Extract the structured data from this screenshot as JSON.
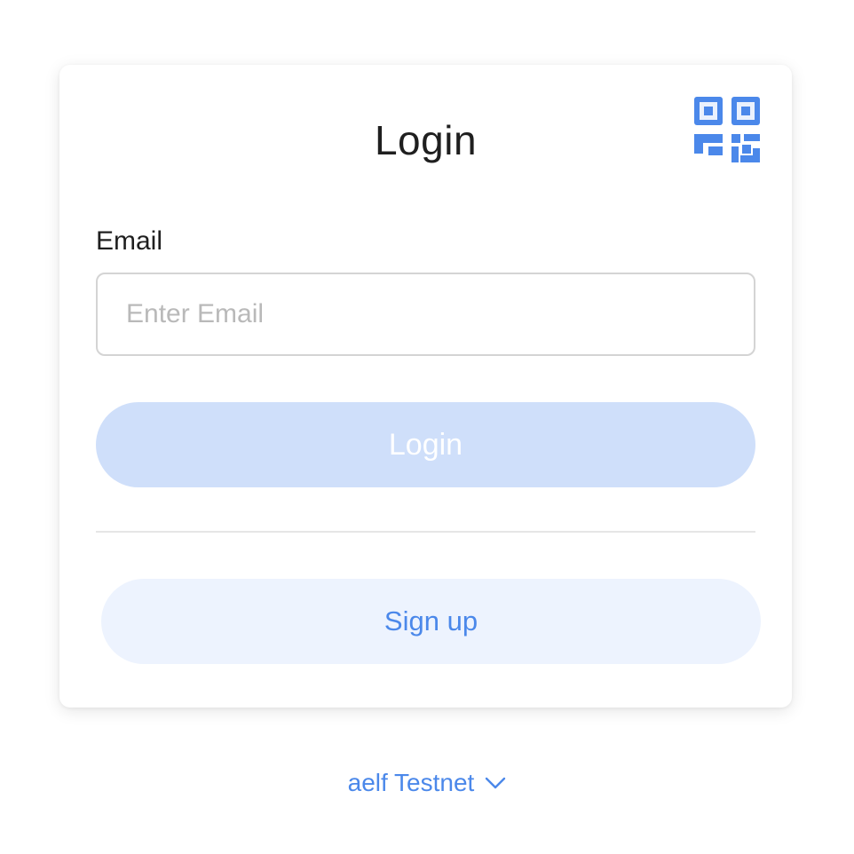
{
  "login_card": {
    "title": "Login",
    "email_label": "Email",
    "email_placeholder": "Enter Email",
    "email_value": "",
    "login_button": "Login",
    "signup_button": "Sign up",
    "qr_icon": "qr-code-icon"
  },
  "footer": {
    "network_label": "aelf Testnet",
    "network_icon": "chevron-down-icon"
  },
  "colors": {
    "accent": "#4b88ea",
    "login_button_bg": "#cfdffa",
    "signup_button_bg": "#edf3fe",
    "qr_corner_bg": "#eaf1fd"
  }
}
